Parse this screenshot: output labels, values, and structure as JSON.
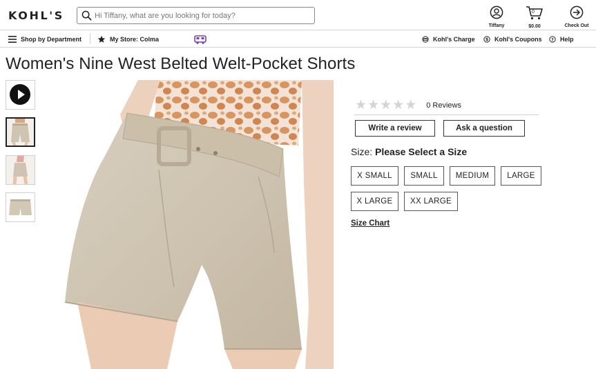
{
  "header": {
    "logo": "KOHL'S",
    "search": {
      "placeholder": "Hi Tiffany, what are you looking for today?"
    },
    "account_label": "Tiffany",
    "cart_total": "$0.00",
    "cart_count": "0",
    "checkout_label": "Check Out"
  },
  "subnav": {
    "shop_by_department": "Shop by Department",
    "my_store": "My Store: Colma",
    "kohls_charge": "Kohl's Charge",
    "kohls_coupons": "Kohl's Coupons",
    "help": "Help"
  },
  "product": {
    "title": "Women's Nine West Belted Welt-Pocket Shorts",
    "rating": {
      "stars": 0,
      "reviews_label": "0 Reviews"
    },
    "write_review_label": "Write a review",
    "ask_question_label": "Ask a question",
    "size_prefix": "Size:",
    "size_prompt": "Please Select a Size",
    "sizes": [
      "X SMALL",
      "SMALL",
      "MEDIUM",
      "LARGE",
      "X LARGE",
      "XX LARGE"
    ],
    "size_chart_label": "Size Chart"
  },
  "icons": {
    "search": "search-icon",
    "account": "user-circle-icon",
    "cart": "shopping-cart-icon",
    "checkout": "arrow-circle-right-icon",
    "menu": "hamburger-menu-icon",
    "store": "star-icon",
    "van": "delivery-van-icon",
    "charge": "credit-card-icon",
    "coupons": "dollar-circle-icon",
    "help": "question-circle-icon",
    "play": "play-icon"
  },
  "colors": {
    "van_icon": "#7b3fbf",
    "star_empty": "#d4d4d4",
    "text": "#222222"
  }
}
